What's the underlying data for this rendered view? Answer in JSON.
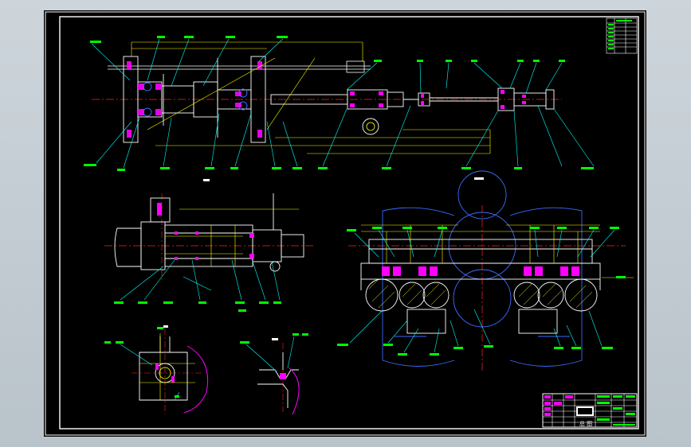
{
  "drawing": {
    "title_block": {
      "name_box": "总图",
      "company": "",
      "sheet_label": "总 图"
    },
    "view_labels": {
      "section_a": "A-A",
      "section_b": "B-B",
      "view_a": "A 向",
      "view_c": "C",
      "view_d": "D"
    },
    "colors": {
      "background": "#000000",
      "border": "#ffffff",
      "lines": "#ffffff",
      "center_lines": "#ff2020",
      "dimensions": "#ffff00",
      "leaders": "#00ffff",
      "hatching": "#ff00ff",
      "parts": "#3c6cff",
      "green": "#00ff00"
    }
  }
}
